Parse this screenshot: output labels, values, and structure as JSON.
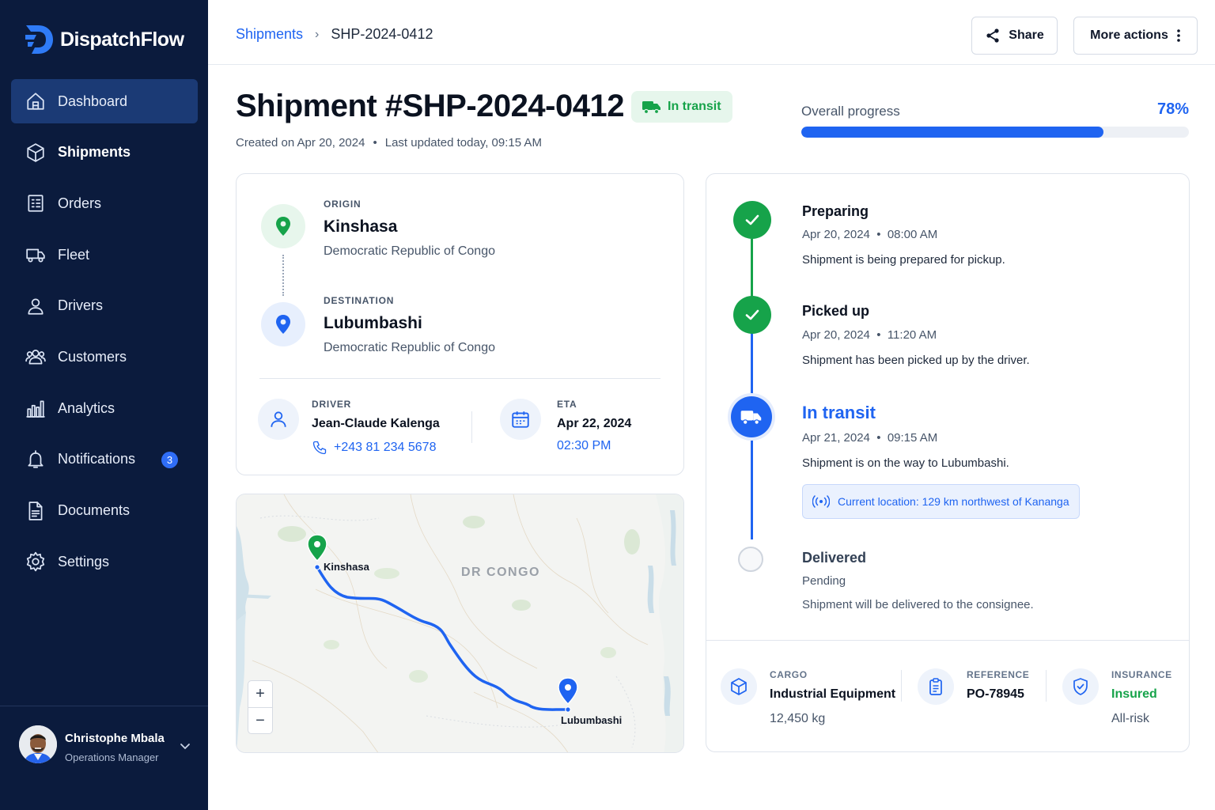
{
  "brand": {
    "name": "DispatchFlow"
  },
  "nav": [
    {
      "label": "Dashboard",
      "icon": "home-icon"
    },
    {
      "label": "Shipments",
      "icon": "box-icon"
    },
    {
      "label": "Orders",
      "icon": "orders-icon"
    },
    {
      "label": "Fleet",
      "icon": "truck-icon"
    },
    {
      "label": "Drivers",
      "icon": "user-icon"
    },
    {
      "label": "Customers",
      "icon": "users-icon"
    },
    {
      "label": "Analytics",
      "icon": "bar-chart-icon"
    },
    {
      "label": "Notifications",
      "icon": "bell-icon",
      "badge": "3"
    },
    {
      "label": "Documents",
      "icon": "document-icon"
    },
    {
      "label": "Settings",
      "icon": "gear-icon"
    }
  ],
  "user": {
    "name": "Christophe Mbala",
    "role": "Operations Manager"
  },
  "breadcrumb": {
    "parent": "Shipments",
    "current": "SHP-2024-0412"
  },
  "actions": {
    "share": "Share",
    "more": "More actions"
  },
  "header": {
    "title": "Shipment #SHP-2024-0412",
    "status": "In transit",
    "created": "Created on Apr 20, 2024",
    "updated": "Last updated today, 09:15 AM"
  },
  "progress": {
    "label": "Overall progress",
    "value_text": "78%",
    "value": 0.78
  },
  "route": {
    "origin": {
      "caption": "ORIGIN",
      "city": "Kinshasa",
      "country": "Democratic Republic of Congo"
    },
    "destination": {
      "caption": "DESTINATION",
      "city": "Lubumbashi",
      "country": "Democratic Republic of Congo"
    },
    "driver": {
      "caption": "DRIVER",
      "name": "Jean-Claude Kalenga",
      "phone": "+243 81 234 5678"
    },
    "eta": {
      "caption": "ETA",
      "date": "Apr 22, 2024",
      "time": "02:30 PM"
    }
  },
  "map": {
    "region": "DR CONGO",
    "origin_label": "Kinshasa",
    "destination_label": "Lubumbashi",
    "zoom_in": "+",
    "zoom_out": "−"
  },
  "timeline": [
    {
      "title": "Preparing",
      "date": "Apr 20, 2024",
      "time": "08:00 AM",
      "desc": "Shipment is being prepared for pickup.",
      "state": "done"
    },
    {
      "title": "Picked up",
      "date": "Apr 20, 2024",
      "time": "11:20 AM",
      "desc": "Shipment has been picked up by the driver.",
      "state": "done"
    },
    {
      "title": "In transit",
      "date": "Apr 21, 2024",
      "time": "09:15 AM",
      "desc": "Shipment is on the way to Lubumbashi.",
      "state": "current",
      "location": "Current location: 129 km northwest of Kananga"
    },
    {
      "title": "Delivered",
      "date": "Pending",
      "time": "",
      "desc": "Shipment will be delivered to the consignee.",
      "state": "pending"
    }
  ],
  "summary": {
    "cargo": {
      "caption": "CARGO",
      "value": "Industrial Equipment",
      "sub": "12,450 kg"
    },
    "reference": {
      "caption": "REFERENCE",
      "value": "PO-78945"
    },
    "insurance": {
      "caption": "INSURANCE",
      "value": "Insured",
      "sub": "All-risk"
    }
  },
  "colors": {
    "sidebar": "#0b1b3d",
    "accent": "#1f64f1",
    "success": "#16a34a"
  }
}
